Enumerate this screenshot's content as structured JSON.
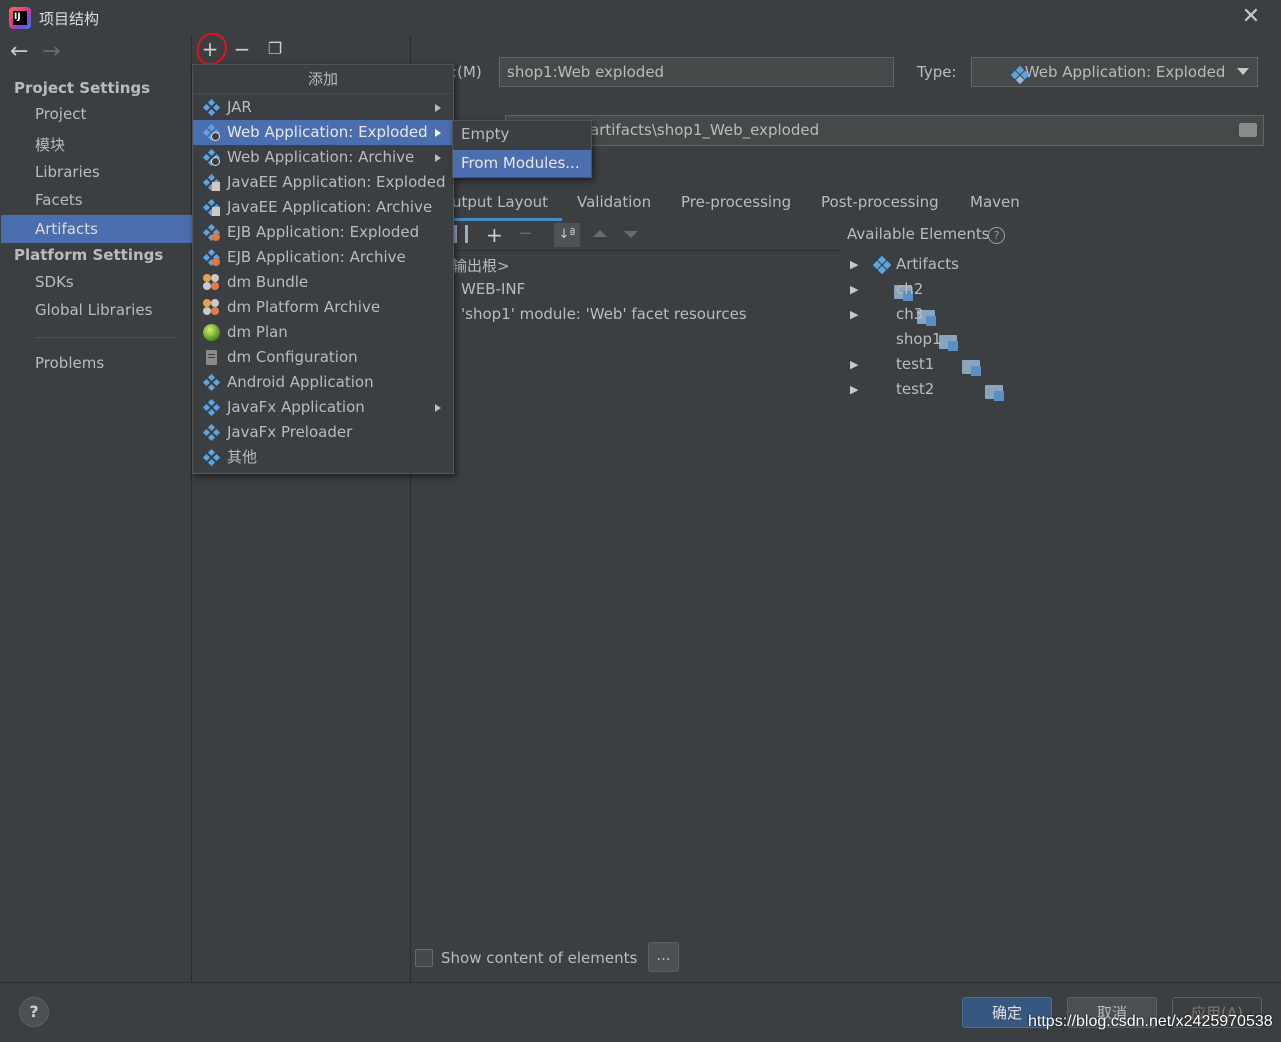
{
  "window": {
    "title": "项目结构",
    "close_icon": "close-icon"
  },
  "sidebar": {
    "project_settings": "Project Settings",
    "project_items": [
      "Project",
      "模块",
      "Libraries",
      "Facets",
      "Artifacts"
    ],
    "selected": "Artifacts",
    "platform_settings": "Platform Settings",
    "platform_items": [
      "SDKs",
      "Global Libraries"
    ],
    "problems": "Problems"
  },
  "popup": {
    "title": "添加",
    "items": [
      {
        "label": "JAR",
        "icon": "diamond",
        "submenu": true
      },
      {
        "label": "Web Application: Exploded",
        "icon": "web",
        "submenu": true,
        "selected": true
      },
      {
        "label": "Web Application: Archive",
        "icon": "web",
        "submenu": true
      },
      {
        "label": "JavaEE Application: Exploded",
        "icon": "javaee"
      },
      {
        "label": "JavaEE Application: Archive",
        "icon": "javaee"
      },
      {
        "label": "EJB Application: Exploded",
        "icon": "ejb"
      },
      {
        "label": "EJB Application: Archive",
        "icon": "ejb"
      },
      {
        "label": "dm Bundle",
        "icon": "bundle"
      },
      {
        "label": "dm Platform Archive",
        "icon": "bundle"
      },
      {
        "label": "dm Plan",
        "icon": "globe"
      },
      {
        "label": "dm Configuration",
        "icon": "doc"
      },
      {
        "label": "Android Application",
        "icon": "diamond"
      },
      {
        "label": "JavaFx Application",
        "icon": "diamond",
        "submenu": true
      },
      {
        "label": "JavaFx Preloader",
        "icon": "diamond"
      },
      {
        "label": "其他",
        "icon": "diamond"
      }
    ],
    "submenu": [
      "Empty",
      "From Modules..."
    ],
    "submenu_selected": "From Modules..."
  },
  "editor": {
    "name_label": ":(M)",
    "name_value": "shop1:Web exploded",
    "type_label": "Type:",
    "type_value": "Web Application: Exploded",
    "output_dir": "artifacts\\shop1_Web_exploded",
    "tabs": [
      "utput Layout",
      "Validation",
      "Pre-processing",
      "Post-processing",
      "Maven"
    ],
    "active_tab": "utput Layout",
    "tree": [
      "输出根>",
      "WEB-INF",
      "'shop1' module: 'Web' facet resources"
    ],
    "available_title": "Available Elements",
    "available": [
      {
        "label": "Artifacts",
        "expandable": true,
        "icon": "diamond"
      },
      {
        "label": "ch2",
        "expandable": true,
        "icon": "folder"
      },
      {
        "label": "ch3",
        "expandable": true,
        "icon": "folder"
      },
      {
        "label": "shop1",
        "expandable": false,
        "icon": "folder"
      },
      {
        "label": "test1",
        "expandable": true,
        "icon": "folder"
      },
      {
        "label": "test2",
        "expandable": true,
        "icon": "folder"
      }
    ],
    "show_content_label": "Show content of elements",
    "more_label": "..."
  },
  "footer": {
    "help": "?",
    "ok": "确定",
    "cancel": "取消",
    "apply": "应用(A)",
    "watermark": "https://blog.csdn.net/x2425970538"
  },
  "colors": {
    "selection": "#4b6eaf",
    "background": "#3c3f41",
    "highlight_circle": "#e8101a"
  }
}
